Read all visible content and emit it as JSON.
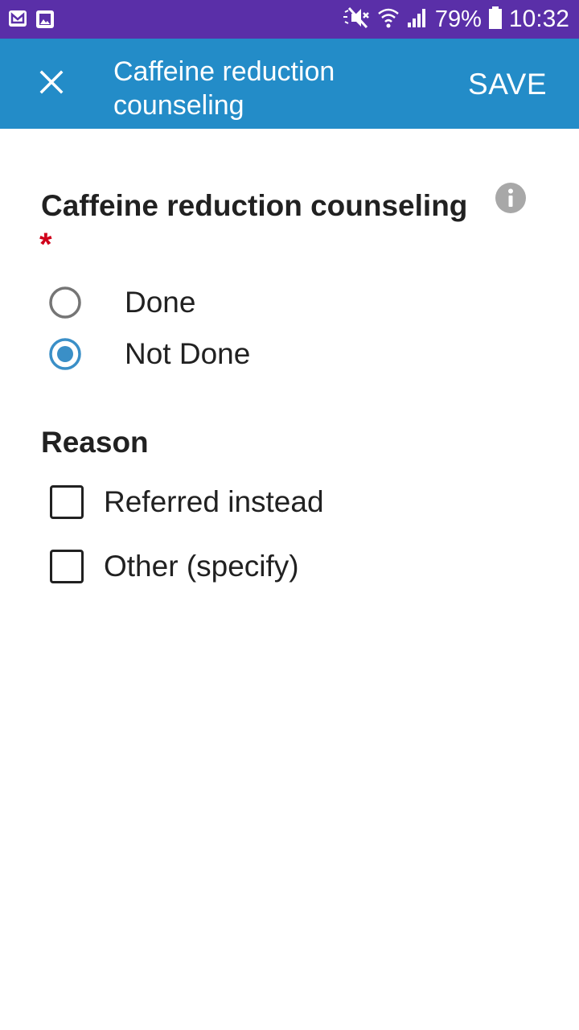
{
  "status_bar": {
    "icons_left": [
      "mail-icon",
      "image-icon"
    ],
    "icons_right": [
      "mute-icon",
      "wifi-icon",
      "signal-icon",
      "battery-icon"
    ],
    "battery_percent": "79%",
    "time": "10:32"
  },
  "app_bar": {
    "title": "Caffeine reduction counseling",
    "save_label": "SAVE",
    "close_icon": "close-icon",
    "background": "#238cc8"
  },
  "question": {
    "title": "Caffeine reduction counseling",
    "required_marker": "*",
    "info_icon": "info-icon",
    "options": [
      {
        "label": "Done",
        "selected": false
      },
      {
        "label": "Not Done",
        "selected": true
      }
    ]
  },
  "reason": {
    "title": "Reason",
    "options": [
      {
        "label": "Referred instead",
        "checked": false
      },
      {
        "label": "Other (specify)",
        "checked": false
      }
    ]
  },
  "colors": {
    "status_bar": "#5a2fa8",
    "accent": "#3a8fc7",
    "required": "#d0021b"
  }
}
